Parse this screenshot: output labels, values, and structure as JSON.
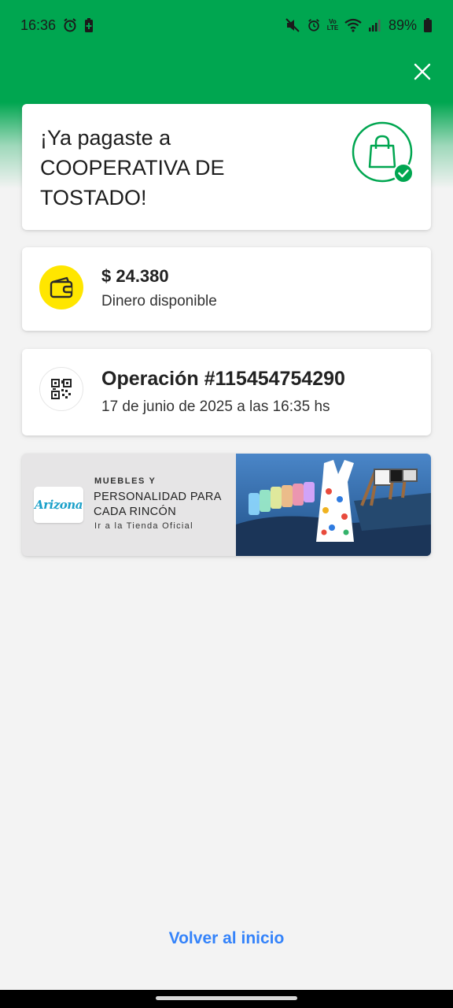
{
  "status_bar": {
    "time": "16:36",
    "volte": "Vo LTE",
    "battery": "89%",
    "icons": [
      "alarm-icon",
      "battery-saver-icon",
      "mute-icon",
      "alarm-icon",
      "volte-icon",
      "wifi-icon",
      "signal-icon",
      "battery-icon"
    ]
  },
  "header": {
    "close_icon": "close-icon",
    "background_color": "#00a650"
  },
  "success": {
    "title": "¡Ya pagaste a COOPERATIVA DE TOSTADO!",
    "icon": "shopping-bag-check-icon"
  },
  "balance": {
    "amount": "$ 24.380",
    "label": "Dinero disponible",
    "icon": "wallet-icon",
    "icon_bg": "#ffe600"
  },
  "operation": {
    "title": "Operación #115454754290",
    "date": "17 de junio de 2025 a las 16:35 hs",
    "icon": "qr-code-icon"
  },
  "ad": {
    "logo_text": "Arizona",
    "line1": "MUEBLES Y",
    "line2": "PERSONALIDAD PARA CADA RINCÓN",
    "link": "Ir a la Tienda Oficial"
  },
  "footer": {
    "back_link": "Volver al inicio",
    "link_color": "#3483fa"
  }
}
